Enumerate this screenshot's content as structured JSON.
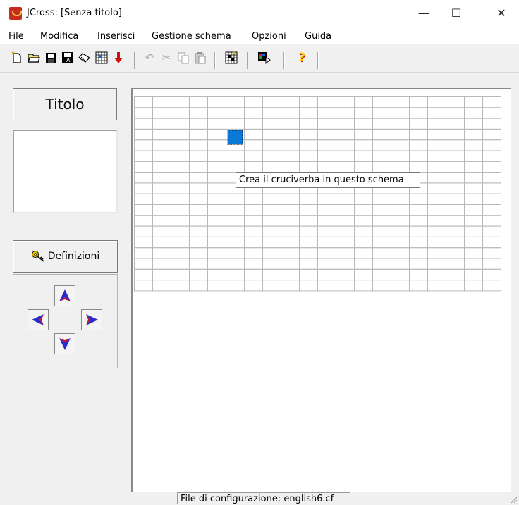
{
  "window": {
    "title": "JCross: [Senza titolo]",
    "minimize_glyph": "—",
    "maximize_glyph": "☐",
    "close_glyph": "✕"
  },
  "menu": [
    "File",
    "Modifica",
    "Inserisci",
    "Gestione schema",
    "Opzioni",
    "Guida"
  ],
  "toolbar": {
    "icons": [
      "new-file-icon",
      "open-folder-icon",
      "save-icon",
      "save-as-icon",
      "eraser-icon",
      "grid-pattern-icon",
      "arrow-down-icon",
      "undo-icon",
      "cut-icon",
      "copy-icon",
      "paste-icon",
      "create-crossword-icon",
      "color-palette-icon",
      "help-icon"
    ],
    "glyphs": {
      "open": "📂",
      "save": "💾",
      "undo": "↶",
      "cut": "✂",
      "help": "?"
    }
  },
  "left_panel": {
    "title_button": "Titolo",
    "definitions_button": "Definizioni"
  },
  "grid": {
    "columns": 20,
    "rows": 18,
    "selected_cell": {
      "col": 5,
      "row": 3
    },
    "selected_color": "#0a78d7"
  },
  "tooltip": "Crea il cruciverba in questo schema",
  "statusbar": {
    "config_file": "File di configurazione: english6.cf"
  },
  "colors": {
    "arrow_blue": "#2a2ad0",
    "arrow_red": "#d01010",
    "help_yellow": "#f2d200",
    "help_red": "#d40000"
  }
}
